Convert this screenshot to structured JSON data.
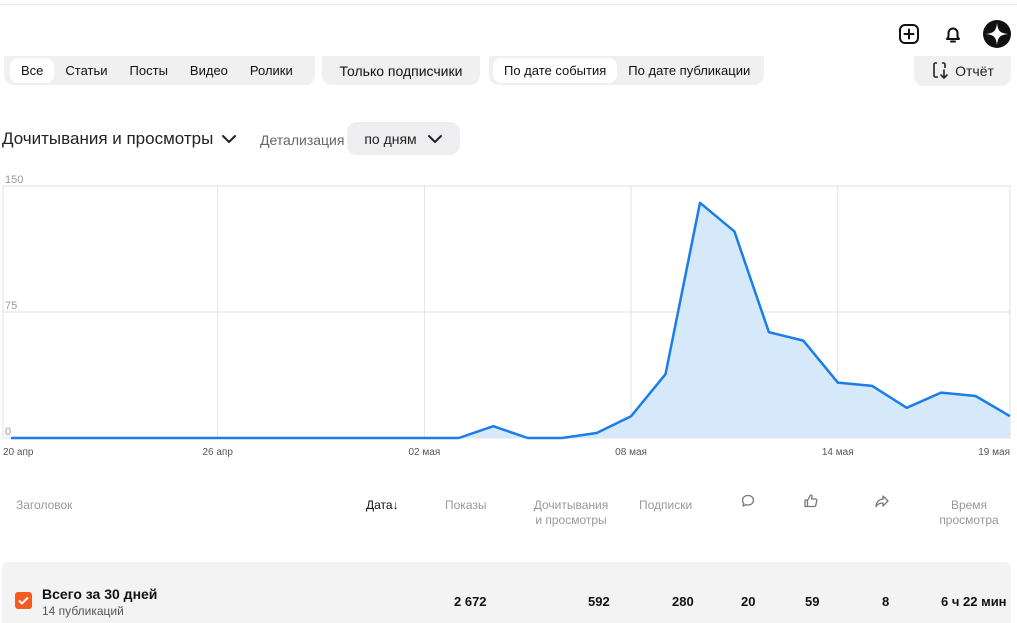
{
  "filters": {
    "types": [
      "Все",
      "Статьи",
      "Посты",
      "Видео",
      "Ролики"
    ],
    "subscribers_only": "Только подписчики",
    "date_modes": [
      "По дате события",
      "По дате публикации"
    ],
    "report": "Отчёт"
  },
  "metric": {
    "label": "Дочитывания и просмотры"
  },
  "detail": {
    "label": "Детализация",
    "value": "по дням"
  },
  "chart_data": {
    "type": "area",
    "x": [
      "20 апр",
      "21 апр",
      "22 апр",
      "23 апр",
      "24 апр",
      "25 апр",
      "26 апр",
      "27 апр",
      "28 апр",
      "29 апр",
      "30 апр",
      "01 мая",
      "02 мая",
      "03 мая",
      "04 мая",
      "05 мая",
      "06 мая",
      "07 мая",
      "08 мая",
      "09 мая",
      "10 мая",
      "11 мая",
      "12 мая",
      "13 мая",
      "14 мая",
      "15 мая",
      "16 мая",
      "17 мая",
      "18 мая",
      "19 мая"
    ],
    "values": [
      0,
      0,
      0,
      0,
      0,
      0,
      0,
      0,
      0,
      0,
      0,
      0,
      0,
      0,
      7,
      0,
      0,
      3,
      13,
      38,
      140,
      123,
      63,
      58,
      33,
      31,
      18,
      27,
      25,
      13
    ],
    "xticks": [
      "20 апр",
      "26 апр",
      "02 мая",
      "08 мая",
      "14 мая",
      "19 мая"
    ],
    "yticks": [
      "150",
      "75",
      "0"
    ],
    "ylim": [
      0,
      150
    ],
    "grid": true,
    "line_color": "#1a7de8",
    "fill_color": "#d6e9fb"
  },
  "table": {
    "headers": {
      "title": "Заголовок",
      "date": "Дата",
      "shows": "Показы",
      "reads": "Дочитывания и просмотры",
      "subs": "Подписки",
      "time": "Время просмотра"
    },
    "total": {
      "title": "Всего за 30 дней",
      "subtitle": "14 публикаций",
      "shows": "2 672",
      "reads": "592",
      "subs": "280",
      "comments": "20",
      "likes": "59",
      "shares": "8",
      "time": "6 ч 22 мин"
    }
  },
  "colors": {
    "accent": "#f55b1f",
    "chart_line": "#1a7de8"
  }
}
